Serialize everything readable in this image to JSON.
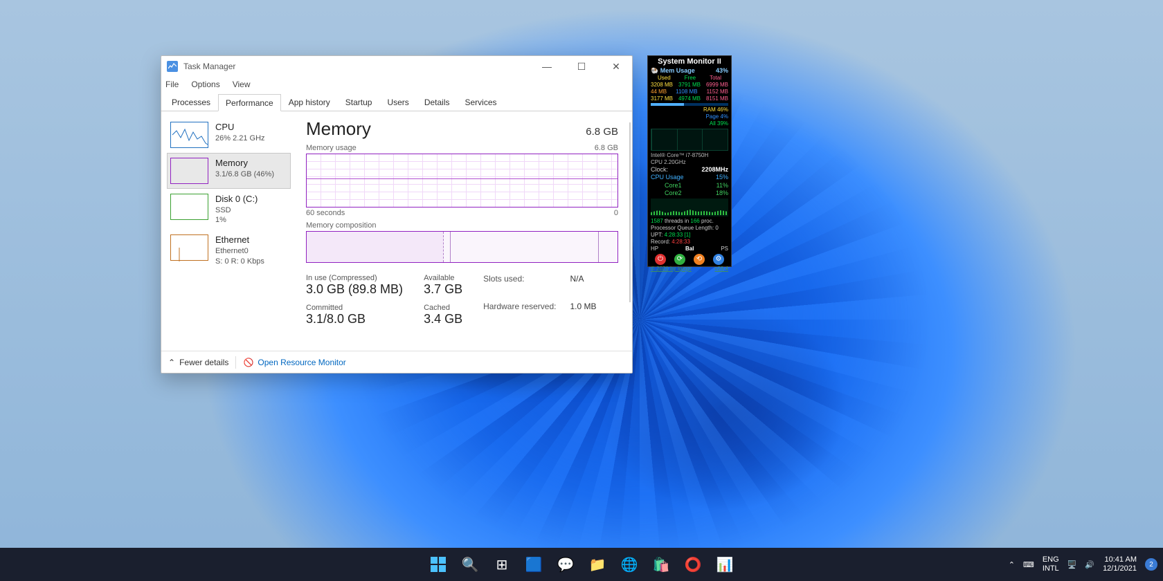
{
  "taskmgr": {
    "title": "Task Manager",
    "menu": {
      "file": "File",
      "options": "Options",
      "view": "View"
    },
    "tabs": [
      "Processes",
      "Performance",
      "App history",
      "Startup",
      "Users",
      "Details",
      "Services"
    ],
    "sidebar": {
      "cpu": {
        "title": "CPU",
        "sub": "26% 2.21 GHz"
      },
      "memory": {
        "title": "Memory",
        "sub": "3.1/6.8 GB (46%)"
      },
      "disk": {
        "title": "Disk 0 (C:)",
        "sub1": "SSD",
        "sub2": "1%"
      },
      "eth": {
        "title": "Ethernet",
        "sub1": "Ethernet0",
        "sub2": "S: 0 R: 0 Kbps"
      }
    },
    "main": {
      "title": "Memory",
      "total": "6.8 GB",
      "usage_label": "Memory usage",
      "usage_max": "6.8 GB",
      "axis_left": "60 seconds",
      "axis_right": "0",
      "comp_label": "Memory composition",
      "inuse_label": "In use (Compressed)",
      "inuse_val": "3.0 GB (89.8 MB)",
      "avail_label": "Available",
      "avail_val": "3.7 GB",
      "commit_label": "Committed",
      "commit_val": "3.1/8.0 GB",
      "cached_label": "Cached",
      "cached_val": "3.4 GB",
      "slots_label": "Slots used:",
      "slots_val": "N/A",
      "hw_label": "Hardware reserved:",
      "hw_val": "1.0 MB"
    },
    "footer": {
      "fewer": "Fewer details",
      "orm": "Open Resource Monitor"
    }
  },
  "gadget": {
    "title": "System Monitor II",
    "mem_label": "Mem Usage",
    "mem_pct": "43%",
    "hdr": {
      "used": "Used",
      "free": "Free",
      "total": "Total"
    },
    "r1": {
      "u": "3208 MB",
      "f": "3791 MB",
      "t": "6999 MB"
    },
    "r2": {
      "u": "44 MB",
      "f": "1108 MB",
      "t": "1152 MB"
    },
    "r3": {
      "u": "3177 MB",
      "f": "4974 MB",
      "t": "8151 MB"
    },
    "ram": "RAM  46%",
    "page": "Page    4%",
    "all": "All   39%",
    "cpu_name": "Intel® Core™ i7-8750H",
    "cpu_ghz": "CPU 2.20GHz",
    "clock_label": "Clock:",
    "clock_val": "2208MHz",
    "cpu_usage_label": "CPU Usage",
    "cpu_usage_val": "15%",
    "core1_label": "Core1",
    "core1_val": "11%",
    "core2_label": "Core2",
    "core2_val": "18%",
    "threads1": "1587",
    "threads2": "threads in",
    "threads3": "166",
    "threads4": "proc.",
    "pql": "Processor Queue Length: 0",
    "upt_label": "UPT:",
    "upt_val": "4:28:33 [1]",
    "rec_label": "Record:",
    "rec_val": "4:28:33",
    "modes": {
      "hp": "HP",
      "bal": "Bal",
      "ps": "PS"
    },
    "footer": "© 2021 by Igogo",
    "ver": "v29.4"
  },
  "taskbar": {
    "lang1": "ENG",
    "lang2": "INTL",
    "time": "10:41 AM",
    "date": "12/1/2021",
    "notif": "2"
  }
}
